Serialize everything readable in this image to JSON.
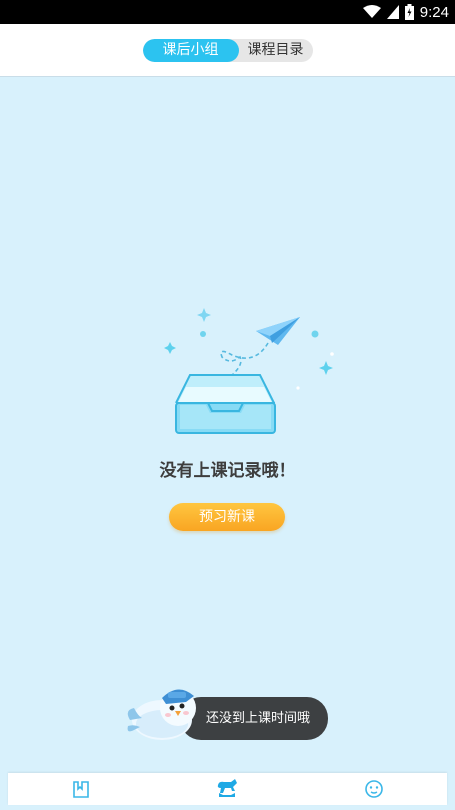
{
  "status_bar": {
    "time": "9:24",
    "icons": [
      "wifi-icon",
      "cellular-signal-icon",
      "battery-icon"
    ]
  },
  "header": {
    "tabs": [
      {
        "label": "课后小组",
        "active": true
      },
      {
        "label": "课程目录",
        "active": false
      }
    ]
  },
  "empty_state": {
    "message": "没有上课记录哦！",
    "button_label": "预习新课",
    "illustration": "inbox-with-paper-plane-icon"
  },
  "toast": {
    "message": "还没到上课时间哦",
    "mascot": "bird-mascot-icon"
  },
  "bottom_nav": {
    "items": [
      {
        "icon": "book-icon",
        "active": false
      },
      {
        "icon": "horse-icon",
        "active": true
      },
      {
        "icon": "smiley-face-icon",
        "active": false
      }
    ]
  },
  "colors": {
    "background": "#d8f1fc",
    "accent": "#2cc3f0",
    "button": "#fbad2b"
  }
}
